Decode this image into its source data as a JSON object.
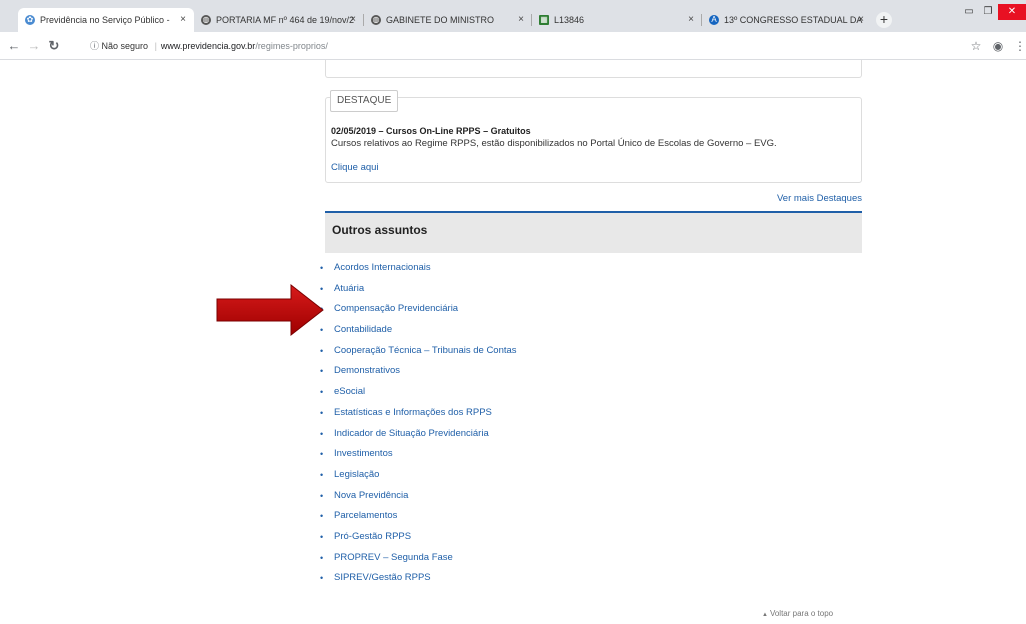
{
  "tabs": [
    {
      "title": "Previdência no Serviço Público - ",
      "active": true,
      "favicon": "leaf-icon",
      "fav_color": "#4a8bd1"
    },
    {
      "title": "PORTARIA MF nº 464 de 19/nov/2",
      "active": false,
      "favicon": "globe-icon",
      "fav_color": "#555555"
    },
    {
      "title": "GABINETE DO MINISTRO",
      "active": false,
      "favicon": "globe-icon",
      "fav_color": "#555555"
    },
    {
      "title": "L13846",
      "active": false,
      "favicon": "flag-icon",
      "fav_color": "#2e7d32"
    },
    {
      "title": "13º CONGRESSO ESTADUAL DA",
      "active": false,
      "favicon": "a-logo-icon",
      "fav_color": "#1565c0"
    }
  ],
  "tab_close_glyph": "×",
  "new_tab_glyph": "+",
  "address": {
    "security_label": "Não seguro",
    "host": "www.previdencia.gov.br",
    "path": "/regimes-proprios/"
  },
  "destaque": {
    "tag": "DESTAQUE",
    "title": "02/05/2019 – Cursos On-Line RPPS – Gratuitos",
    "text": "Cursos relativos ao Regime RPPS, estão disponibilizados no Portal Único de Escolas de Governo – EVG.",
    "link": "Clique aqui"
  },
  "ver_mais": "Ver mais Destaques",
  "outros": {
    "title": "Outros assuntos",
    "items": [
      "Acordos Internacionais",
      "Atuária",
      "Compensação Previdenciária",
      "Contabilidade",
      "Cooperação Técnica – Tribunais de Contas",
      "Demonstrativos",
      "eSocial",
      "Estatísticas e Informações dos RPPS",
      "Indicador de Situação Previdenciária",
      "Investimentos",
      "Legislação",
      "Nova Previdência",
      "Parcelamentos",
      "Pró-Gestão RPPS",
      "PROPREV – Segunda Fase",
      "SIPREV/Gestão RPPS"
    ],
    "highlighted_item": "Compensação Previdenciária"
  },
  "voltar": "Voltar para o topo",
  "colors": {
    "link": "#1f5fa8",
    "arrow": "#c00000",
    "header_bg": "#e8e8e8"
  }
}
